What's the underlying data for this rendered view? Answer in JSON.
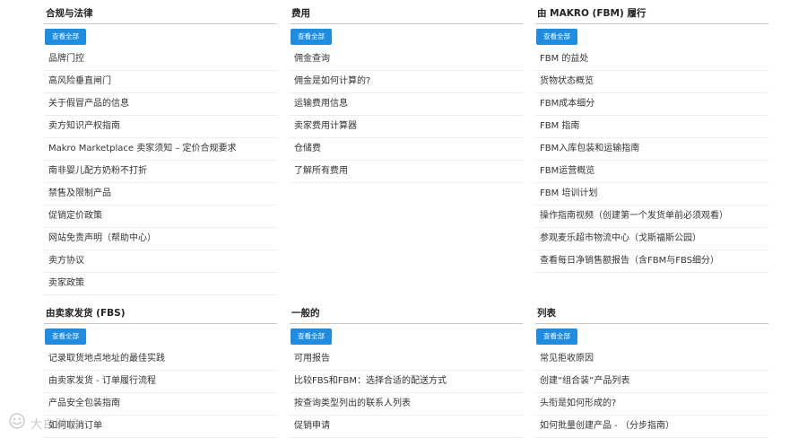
{
  "sections": [
    {
      "title": "合规与法律",
      "button": "查看全部",
      "items": [
        "品牌门控",
        "高风险垂直闸门",
        "关于假冒产品的信息",
        "卖方知识产权指南",
        "Makro Marketplace 卖家须知 – 定价合规要求",
        "南非婴儿配方奶粉不打折",
        "禁售及限制产品",
        "促销定价政策",
        "网站免责声明（帮助中心）",
        "卖方协议",
        "卖家政策"
      ]
    },
    {
      "title": "费用",
      "button": "查看全部",
      "items": [
        "佣金查询",
        "佣金是如何计算的?",
        "运输费用信息",
        "卖家费用计算器",
        "仓储费",
        "了解所有费用"
      ]
    },
    {
      "title": "由 MAKRO (FBM) 履行",
      "button": "查看全部",
      "items": [
        "FBM 的益处",
        "货物状态概览",
        "FBM成本细分",
        "FBM 指南",
        "FBM入库包装和运输指南",
        "FBM运营概览",
        "FBM 培训计划",
        "操作指南视频（创建第一个发货单前必须观看）",
        "参观麦乐超市物流中心（戈斯福斯公园）",
        "查看每日净销售额报告（含FBM与FBS细分）"
      ]
    },
    {
      "title": "由卖家发货 (FBS)",
      "button": "查看全部",
      "items": [
        "记录取货地点地址的最佳实践",
        "由卖家发货 - 订单履行流程",
        "产品安全包装指南",
        "如何取消订单"
      ]
    },
    {
      "title": "一般的",
      "button": "查看全部",
      "items": [
        "可用报告",
        "比较FBS和FBM：选择合适的配送方式",
        "按查询类型列出的联系人列表",
        "促销申请"
      ]
    },
    {
      "title": "列表",
      "button": "查看全部",
      "items": [
        "常见拒收原因",
        "创建“组合装”产品列表",
        "头衔是如何形成的?",
        "如何批量创建产品 - （分步指南）"
      ]
    }
  ],
  "watermark": {
    "text": "大白跨境"
  }
}
